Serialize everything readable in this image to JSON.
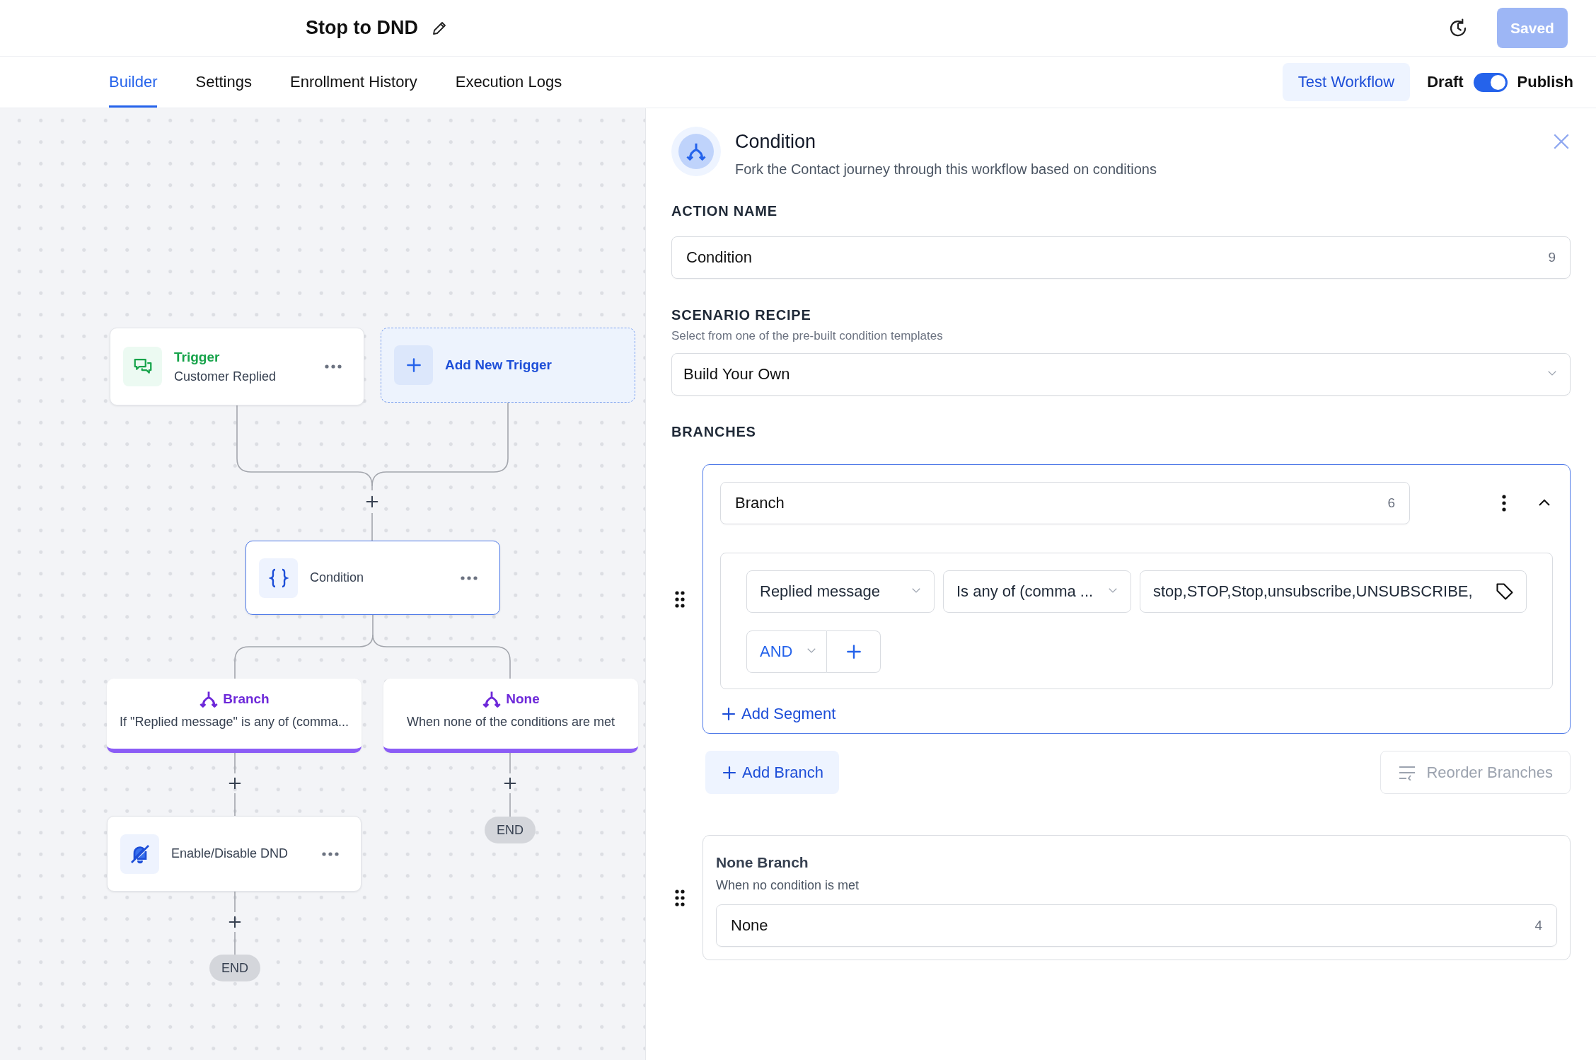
{
  "header": {
    "title": "Stop to DND",
    "saved_button": "Saved"
  },
  "tabs": [
    {
      "label": "Builder",
      "selected": true
    },
    {
      "label": "Settings",
      "selected": false
    },
    {
      "label": "Enrollment History",
      "selected": false
    },
    {
      "label": "Execution Logs",
      "selected": false
    }
  ],
  "test_workflow_button": "Test Workflow",
  "publish_toggle": {
    "off_label": "Draft",
    "on_label": "Publish",
    "on": true
  },
  "canvas": {
    "trigger_node": {
      "label": "Trigger",
      "text": "Customer Replied"
    },
    "add_trigger": "Add New Trigger",
    "condition_node": "Condition",
    "branch_nodes": [
      {
        "title": "Branch",
        "description": "If \"Replied message\" is any of (comma..."
      },
      {
        "title": "None",
        "description": "When none of the conditions are met"
      }
    ],
    "action_node": "Enable/Disable DND",
    "end_labels": [
      "END",
      "END"
    ]
  },
  "panel": {
    "title": "Condition",
    "description": "Fork the Contact journey through this workflow based on conditions",
    "action_name": {
      "label": "ACTION NAME",
      "value": "Condition",
      "count": "9"
    },
    "scenario_recipe": {
      "label": "SCENARIO RECIPE",
      "hint": "Select from one of the pre-built condition templates",
      "value": "Build Your Own"
    },
    "branches_label": "BRANCHES",
    "branch": {
      "name": "Branch",
      "count": "6",
      "expanded": true,
      "condition": {
        "field": "Replied message",
        "operator": "Is any of (comma ...",
        "value": "stop,STOP,Stop,unsubscribe,UNSUBSCRIBE,"
      },
      "connector": "AND",
      "add_segment": "Add Segment"
    },
    "add_branch": "Add Branch",
    "reorder_branches": "Reorder Branches",
    "none_branch": {
      "title": "None Branch",
      "hint": "When no condition is met",
      "value": "None",
      "count": "4"
    }
  }
}
